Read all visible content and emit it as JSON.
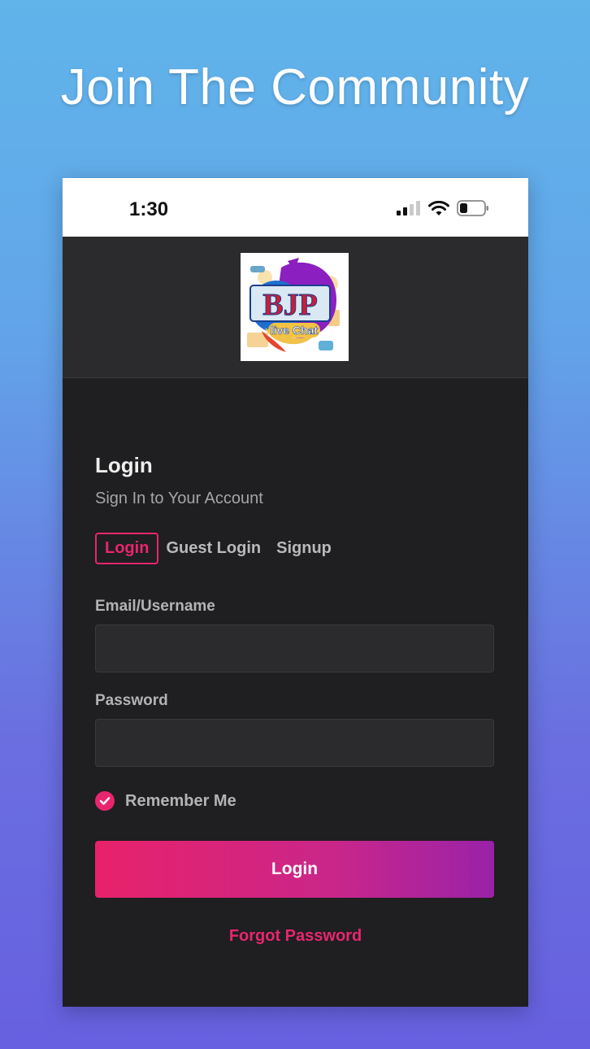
{
  "headline": "Join The Community",
  "status_bar": {
    "time": "1:30",
    "icons": [
      "cellular-signal-icon",
      "wifi-icon",
      "battery-icon"
    ]
  },
  "logo": {
    "text_main": "BJP",
    "text_sub": "live Chat"
  },
  "login": {
    "title": "Login",
    "subtitle": "Sign In to Your Account",
    "tabs": [
      {
        "label": "Login",
        "active": true
      },
      {
        "label": "Guest Login",
        "active": false
      },
      {
        "label": "Signup",
        "active": false
      }
    ],
    "email_label": "Email/Username",
    "email_value": "",
    "password_label": "Password",
    "password_value": "",
    "remember_label": "Remember Me",
    "remember_checked": true,
    "submit_label": "Login",
    "forgot_label": "Forgot Password"
  },
  "colors": {
    "accent": "#e8266e",
    "gradient_end": "#9a22a8",
    "panel_bg": "#1f1e20",
    "header_bg": "#2b2a2c"
  }
}
